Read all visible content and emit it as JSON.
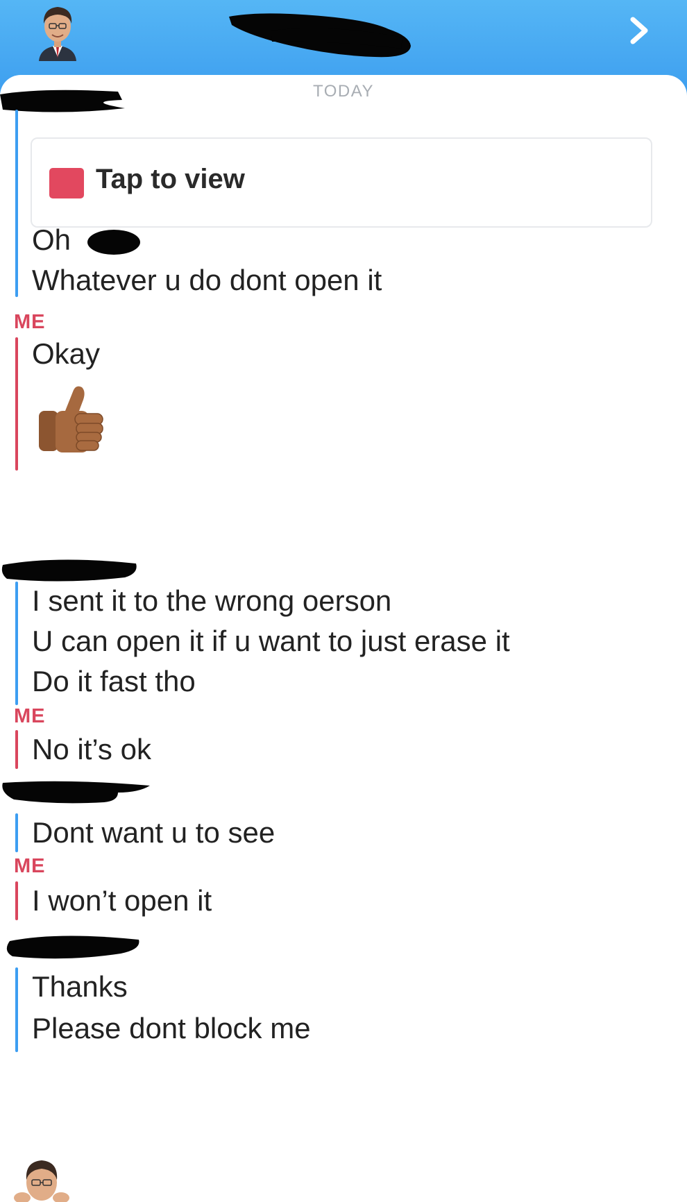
{
  "header": {
    "chevron_icon": "chevron-right-icon",
    "avatar_icon": "bitmoji-avatar-icon",
    "accent": "#3d9eef"
  },
  "chat": {
    "date_label": "TODAY",
    "snap_label": "Tap to view",
    "snap_icon": "red-snap-square-icon",
    "me_label": "ME",
    "messages": [
      {
        "sender": "them",
        "lines": [
          "Oh",
          "Whatever u do dont open it"
        ]
      },
      {
        "sender": "me",
        "lines": [
          "Okay"
        ],
        "emoji": "thumbs-up-medium-dark-skin-icon"
      },
      {
        "sender": "them",
        "lines": [
          "I sent it to the wrong oerson",
          "U can open it if u want to just erase it",
          "Do it fast tho"
        ]
      },
      {
        "sender": "me",
        "lines": [
          "No it’s ok"
        ]
      },
      {
        "sender": "them",
        "lines": [
          "Dont want u to see"
        ]
      },
      {
        "sender": "me",
        "lines": [
          "I won’t open it"
        ]
      },
      {
        "sender": "them",
        "lines": [
          "Thanks",
          "Please dont block me"
        ]
      }
    ]
  },
  "colors": {
    "them_bar": "#3d9ef2",
    "me_bar": "#d9465d",
    "snap_red": "#e2485f"
  }
}
